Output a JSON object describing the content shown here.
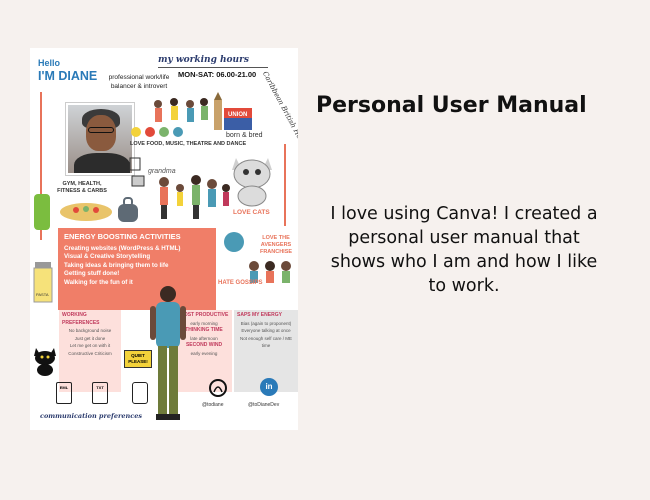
{
  "page": {
    "title": "Personal User Manual",
    "description": "I love using Canva! I created a personal user manual that shows who I am and how I like to work."
  },
  "poster": {
    "hello": "Hello",
    "name": "I'M DIANE",
    "headline": "my working hours",
    "tagline": "professional work/life balancer & introvert",
    "hours": "MON-SAT: 06.00-21.00",
    "heritage": "Caribbean British Heritage",
    "born": "born & bred",
    "loves": "LOVE FOOD, MUSIC, THEATRE AND DANCE",
    "grandma": "grandma",
    "gym": "GYM, HEALTH, FITNESS & CARBS",
    "cats": "LOVE CATS",
    "energy_title": "ENERGY BOOSTING ACTIVITIES",
    "energy_items": [
      "Creating websites (WordPress & HTML)",
      "Visual & Creative Storytelling",
      "Taking ideas & bringing them to life",
      "Getting stuff done!",
      "Walking for the fun of it"
    ],
    "avengers": "LOVE THE AVENGERS FRANCHISE",
    "gossips": "HATE GOSSIPS",
    "working_prefs": {
      "title": "WORKING PREFERENCES",
      "items": [
        "No background noise",
        "Just get it done",
        "Let me get on with it",
        "Constructive Criticism"
      ]
    },
    "productive": {
      "title": "MOST PRODUCTIVE",
      "sub": "early morning",
      "t2": "THINKING TIME",
      "s2": "late afternoon",
      "t3": "SECOND WIND",
      "s3": "early evening"
    },
    "saps": {
      "title": "SAPS MY ENERGY",
      "items": [
        "Bias (again to proponent)",
        "Everyone talking at once",
        "Not enough self care / ME time"
      ]
    },
    "quiet": "QUIET PLEASE!",
    "comm_label": "communication preferences",
    "icons": {
      "eml": "EML",
      "txt": "TXT"
    },
    "github": "@todiane",
    "linkedin_letter": "in",
    "linkedin": "@toDianeDev",
    "colors": {
      "accent": "#f07e68",
      "blue": "#2a7ab8",
      "navy": "#2b3b6d"
    }
  }
}
